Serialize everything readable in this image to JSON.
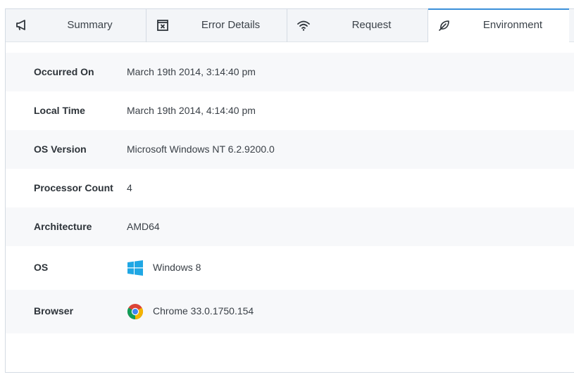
{
  "tabs": [
    {
      "label": "Summary",
      "icon": "megaphone-icon",
      "active": false
    },
    {
      "label": "Error Details",
      "icon": "error-window-icon",
      "active": false
    },
    {
      "label": "Request",
      "icon": "wifi-icon",
      "active": false
    },
    {
      "label": "Environment",
      "icon": "leaf-icon",
      "active": true
    }
  ],
  "environment": {
    "occurred_on": {
      "label": "Occurred On",
      "value": "March 19th 2014, 3:14:40 pm"
    },
    "local_time": {
      "label": "Local Time",
      "value": "March 19th 2014, 4:14:40 pm"
    },
    "os_version": {
      "label": "OS Version",
      "value": "Microsoft Windows NT 6.2.9200.0"
    },
    "processor_count": {
      "label": "Processor Count",
      "value": "4"
    },
    "architecture": {
      "label": "Architecture",
      "value": "AMD64"
    },
    "os": {
      "label": "OS",
      "value": "Windows 8",
      "icon": "windows-logo-icon"
    },
    "browser": {
      "label": "Browser",
      "value": "Chrome 33.0.1750.154",
      "icon": "chrome-logo-icon"
    }
  },
  "colors": {
    "accent": "#3b8fd9",
    "windows_blue": "#1fa7e4"
  }
}
